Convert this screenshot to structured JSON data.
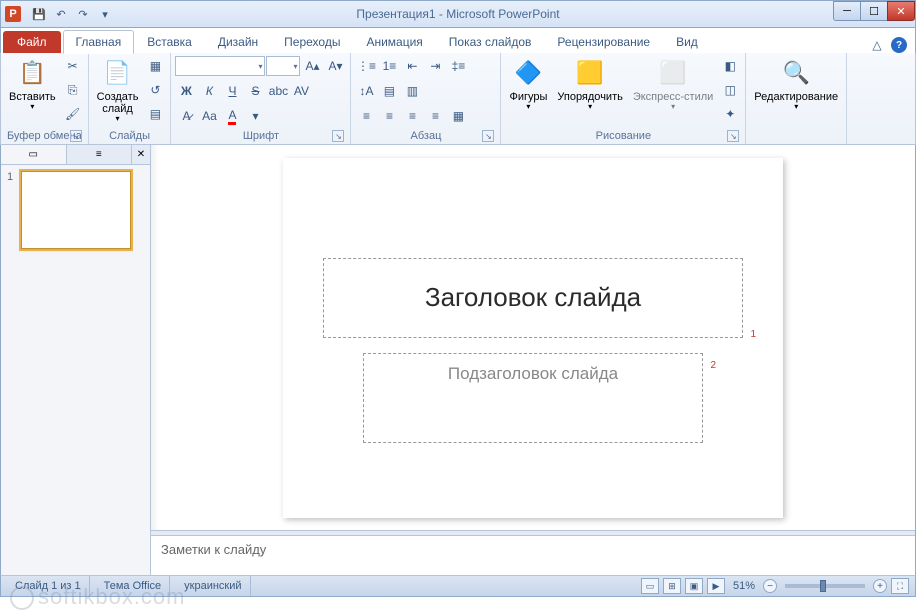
{
  "title": "Презентация1 - Microsoft PowerPoint",
  "app_letter": "P",
  "tabs": {
    "file": "Файл",
    "items": [
      "Главная",
      "Вставка",
      "Дизайн",
      "Переходы",
      "Анимация",
      "Показ слайдов",
      "Рецензирование",
      "Вид"
    ],
    "active": 0
  },
  "ribbon": {
    "clipboard": {
      "paste": "Вставить",
      "label": "Буфер обмена"
    },
    "slides": {
      "new": "Создать\nслайд",
      "label": "Слайды"
    },
    "font_label": "Шрифт",
    "paragraph_label": "Абзац",
    "drawing": {
      "shapes": "Фигуры",
      "arrange": "Упорядочить",
      "styles": "Экспресс-стили",
      "label": "Рисование"
    },
    "editing": {
      "label": "Редактирование"
    }
  },
  "thumbs": {
    "num1": "1"
  },
  "slide": {
    "title_placeholder": "Заголовок слайда",
    "subtitle_placeholder": "Подзаголовок слайда",
    "ann1": "1",
    "ann2": "2"
  },
  "notes_placeholder": "Заметки к слайду",
  "status": {
    "slide_info": "Слайд 1 из 1",
    "theme": "Тема Office",
    "lang": "украинский",
    "zoom": "51%"
  },
  "watermark": "softikbox.com"
}
